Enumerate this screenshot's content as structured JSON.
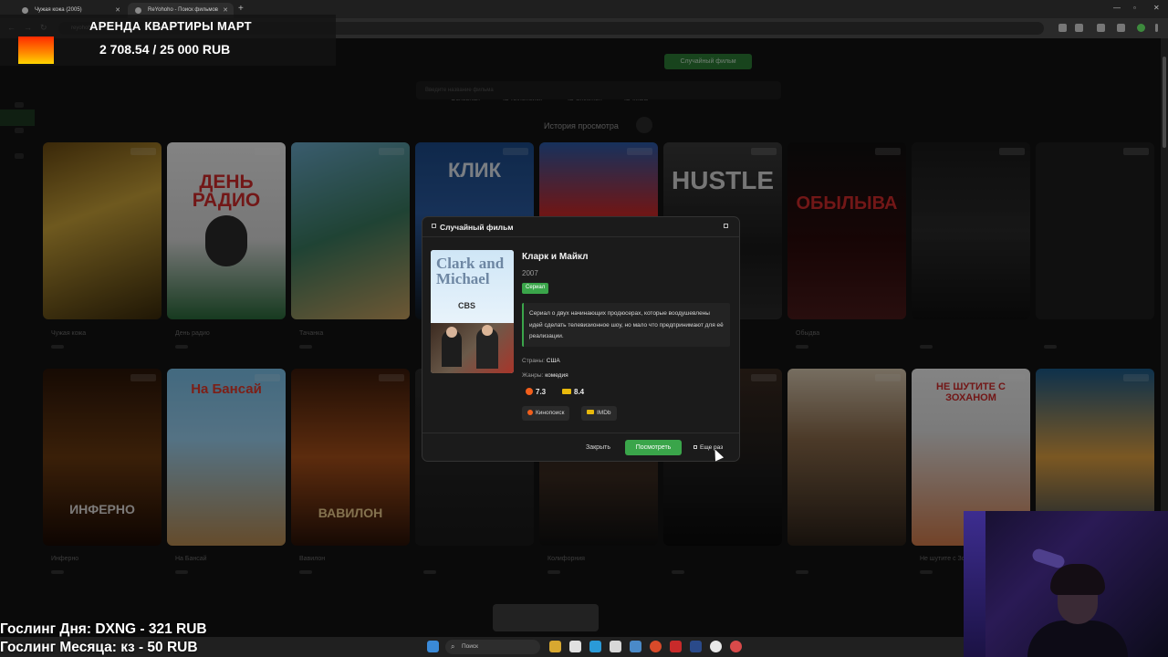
{
  "browser": {
    "tabs": [
      {
        "title": "Чужая кожа (2005)",
        "active": false
      },
      {
        "title": "ReYohoho - Поиск фильмов",
        "active": true
      }
    ],
    "url": "reyohoho"
  },
  "site": {
    "nav": [
      "Основная",
      "ID Кинопоиск",
      "ID Shikimori",
      "ID IMDB",
      "Случайный фильм"
    ],
    "search_placeholder": "Введите название фильма",
    "history_title": "История просмотра",
    "row1": [
      "Чужая кожа",
      "День радио",
      "Тачанка",
      "Клик",
      "",
      "Hustle",
      "Обыдва",
      "",
      ""
    ],
    "row2": [
      "Инферно",
      "На Бансай",
      "Вавилон",
      "",
      "Колифорния",
      "",
      "",
      "Не шутите с Зоханом",
      ""
    ]
  },
  "modal": {
    "title": "Случайный фильм",
    "film_title": "Кларк и Майкл",
    "year": "2007",
    "type_badge": "Сериал",
    "description": "Сериал о двух начинающих продюсерах, которые воодушевлены идей сделать телевизионное шоу, но мало что предпринимают для её реализации.",
    "countries_label": "Страны:",
    "countries": "США",
    "genres_label": "Жанры:",
    "genres": "комедия",
    "rating_kp": "7.3",
    "rating_imdb": "8.4",
    "link_kp": "Кинопоиск",
    "link_imdb": "IMDb",
    "close_label": "Закрыть",
    "watch_label": "Посмотреть",
    "again_label": "Еще раз",
    "cover_title": "Clark and Michael",
    "cover_network": "CBS"
  },
  "overlay": {
    "goal_title": "АРЕНДА КВАРТИРЫ МАРТ",
    "goal_progress": "2 708.54 / 25 000 RUB",
    "gosling_day": "Гослинг Дня: DXNG - 321 RUB",
    "gosling_month": "Гослинг Месяца: кз - 50 RUB"
  },
  "taskbar": {
    "search_label": "Поиск"
  },
  "colors": {
    "accent_green": "#3aa54a",
    "kp_orange": "#f25f1c",
    "imdb_yellow": "#e8b90c"
  }
}
